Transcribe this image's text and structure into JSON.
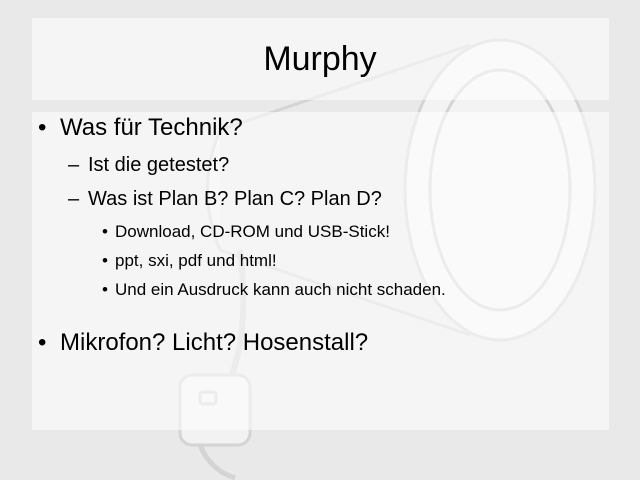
{
  "slide": {
    "title": "Murphy",
    "items": [
      {
        "text": "Was für Technik?",
        "subitems": [
          {
            "text": "Ist die getestet?"
          },
          {
            "text": "Was ist Plan B? Plan C? Plan D?",
            "subitems": [
              {
                "text": "Download, CD-ROM und USB-Stick!"
              },
              {
                "text": "ppt, sxi, pdf und html!"
              },
              {
                "text": "Und ein Ausdruck kann auch nicht schaden."
              }
            ]
          }
        ]
      },
      {
        "text": "Mikrofon? Licht? Hosenstall?"
      }
    ],
    "markers": {
      "level1": "•",
      "level2": "–",
      "level3": "•"
    }
  }
}
